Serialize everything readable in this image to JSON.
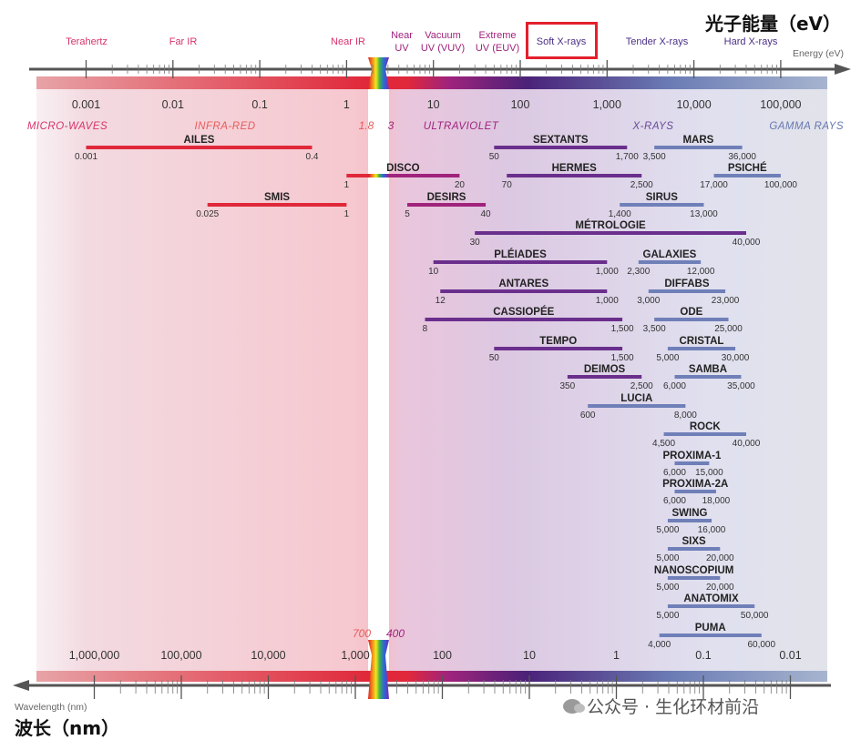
{
  "titles": {
    "energy_cn": "光子能量（eV）",
    "wavelength_cn": "波长（nm）",
    "energy_unit": "Energy (eV)",
    "wavelength_unit": "Wavelength (nm)"
  },
  "regions_top": [
    {
      "label": "Terahertz",
      "color": "#d6336c"
    },
    {
      "label": "Far IR",
      "color": "#d6336c"
    },
    {
      "label": "Near IR",
      "color": "#d6336c"
    },
    {
      "label": "Near\nUV",
      "color": "#a0237c"
    },
    {
      "label": "Vacuum\nUV (VUV)",
      "color": "#a0237c"
    },
    {
      "label": "Extreme\nUV (EUV)",
      "color": "#a0237c"
    },
    {
      "label": "Soft X-rays",
      "color": "#4a2f86",
      "highlighted": true
    },
    {
      "label": "Tender X-rays",
      "color": "#4a2f86"
    },
    {
      "label": "Hard X-rays",
      "color": "#4a2f86"
    }
  ],
  "energy_ticks": [
    {
      "value": 0.001,
      "label": "0.001"
    },
    {
      "value": 0.01,
      "label": "0.01"
    },
    {
      "value": 0.1,
      "label": "0.1"
    },
    {
      "value": 1,
      "label": "1"
    },
    {
      "value": 10,
      "label": "10"
    },
    {
      "value": 100,
      "label": "100"
    },
    {
      "value": 1000,
      "label": "1,000"
    },
    {
      "value": 10000,
      "label": "10,000"
    },
    {
      "value": 100000,
      "label": "100,000"
    }
  ],
  "wavelength_ticks": [
    {
      "value": 1000000,
      "label": "1,000,000"
    },
    {
      "value": 100000,
      "label": "100,000"
    },
    {
      "value": 10000,
      "label": "10,000"
    },
    {
      "value": 1000,
      "label": "1,000"
    },
    {
      "value": 100,
      "label": "100"
    },
    {
      "value": 10,
      "label": "10"
    },
    {
      "value": 1,
      "label": "1"
    },
    {
      "value": 0.1,
      "label": "0.1"
    },
    {
      "value": 0.01,
      "label": "0.01"
    }
  ],
  "bands": [
    {
      "label": "MICRO-WAVES",
      "color": "#d6336c"
    },
    {
      "label": "INFRA-RED",
      "color": "#e85a5a"
    },
    {
      "label": "ULTRAVIOLET",
      "color": "#a0237c"
    },
    {
      "label": "X-RAYS",
      "color": "#6a4a9a"
    },
    {
      "label": "GAMMA RAYS",
      "color": "#6677b0"
    }
  ],
  "visible_energy_labels": [
    "1.8",
    "3"
  ],
  "visible_wavelength_labels": [
    "700",
    "400"
  ],
  "beamlines": [
    {
      "name": "AILES",
      "min": 0.001,
      "max": 0.4,
      "min_label": "0.001",
      "max_label": "0.4"
    },
    {
      "name": "DISCO",
      "min": 1,
      "max": 20,
      "min_label": "1",
      "max_label": "20"
    },
    {
      "name": "SMIS",
      "min": 0.025,
      "max": 1,
      "min_label": "0.025",
      "max_label": "1"
    },
    {
      "name": "DESIRS",
      "min": 5,
      "max": 40,
      "min_label": "5",
      "max_label": "40"
    },
    {
      "name": "SEXTANTS",
      "min": 50,
      "max": 1700,
      "min_label": "50",
      "max_label": "1,700"
    },
    {
      "name": "HERMES",
      "min": 70,
      "max": 2500,
      "min_label": "70",
      "max_label": "2,500"
    },
    {
      "name": "MÉTROLOGIE",
      "min": 30,
      "max": 40000,
      "min_label": "30",
      "max_label": "40,000"
    },
    {
      "name": "PLÉIADES",
      "min": 10,
      "max": 1000,
      "min_label": "10",
      "max_label": "1,000"
    },
    {
      "name": "ANTARES",
      "min": 12,
      "max": 1000,
      "min_label": "12",
      "max_label": "1,000"
    },
    {
      "name": "CASSIOPÉE",
      "min": 8,
      "max": 1500,
      "min_label": "8",
      "max_label": "1,500"
    },
    {
      "name": "TEMPO",
      "min": 50,
      "max": 1500,
      "min_label": "50",
      "max_label": "1,500"
    },
    {
      "name": "DEIMOS",
      "min": 350,
      "max": 2500,
      "min_label": "350",
      "max_label": "2,500"
    },
    {
      "name": "LUCIA",
      "min": 600,
      "max": 8000,
      "min_label": "600",
      "max_label": "8,000"
    },
    {
      "name": "MARS",
      "min": 3500,
      "max": 36000,
      "min_label": "3,500",
      "max_label": "36,000"
    },
    {
      "name": "PSICHÉ",
      "min": 17000,
      "max": 100000,
      "min_label": "17,000",
      "max_label": "100,000"
    },
    {
      "name": "SIRUS",
      "min": 1400,
      "max": 13000,
      "min_label": "1,400",
      "max_label": "13,000"
    },
    {
      "name": "GALAXIES",
      "min": 2300,
      "max": 12000,
      "min_label": "2,300",
      "max_label": "12,000"
    },
    {
      "name": "DIFFABS",
      "min": 3000,
      "max": 23000,
      "min_label": "3,000",
      "max_label": "23,000"
    },
    {
      "name": "ODE",
      "min": 3500,
      "max": 25000,
      "min_label": "3,500",
      "max_label": "25,000"
    },
    {
      "name": "CRISTAL",
      "min": 5000,
      "max": 30000,
      "min_label": "5,000",
      "max_label": "30,000"
    },
    {
      "name": "SAMBA",
      "min": 6000,
      "max": 35000,
      "min_label": "6,000",
      "max_label": "35,000"
    },
    {
      "name": "ROCK",
      "min": 4500,
      "max": 40000,
      "min_label": "4,500",
      "max_label": "40,000"
    },
    {
      "name": "PROXIMA-1",
      "min": 6000,
      "max": 15000,
      "min_label": "6,000",
      "max_label": "15,000"
    },
    {
      "name": "PROXIMA-2A",
      "min": 6000,
      "max": 18000,
      "min_label": "6,000",
      "max_label": "18,000"
    },
    {
      "name": "SWING",
      "min": 5000,
      "max": 16000,
      "min_label": "5,000",
      "max_label": "16,000"
    },
    {
      "name": "SIXS",
      "min": 5000,
      "max": 20000,
      "min_label": "5,000",
      "max_label": "20,000"
    },
    {
      "name": "NANOSCOPIUM",
      "min": 5000,
      "max": 20000,
      "min_label": "5,000",
      "max_label": "20,000"
    },
    {
      "name": "ANATOMIX",
      "min": 5000,
      "max": 50000,
      "min_label": "5,000",
      "max_label": "50,000"
    },
    {
      "name": "PUMA",
      "min": 4000,
      "max": 60000,
      "min_label": "4,000",
      "max_label": "60,000"
    }
  ],
  "watermark": "公众号 · 生化环材前沿"
}
